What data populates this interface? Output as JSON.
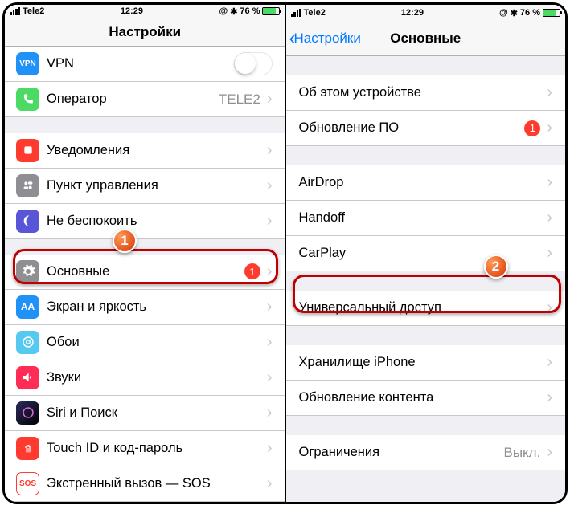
{
  "status": {
    "carrier": "Tele2",
    "time": "12:29",
    "battery_pct": "76 %"
  },
  "left": {
    "title": "Настройки",
    "rows": {
      "vpn": "VPN",
      "carrier": "Оператор",
      "carrier_value": "TELE2",
      "notifications": "Уведомления",
      "control_center": "Пункт управления",
      "dnd": "Не беспокоить",
      "general": "Основные",
      "general_badge": "1",
      "display": "Экран и яркость",
      "wallpaper": "Обои",
      "sounds": "Звуки",
      "siri": "Siri и Поиск",
      "touchid": "Touch ID и код-пароль",
      "sos": "Экстренный вызов — SOS"
    }
  },
  "right": {
    "back": "Настройки",
    "title": "Основные",
    "rows": {
      "about": "Об этом устройстве",
      "update": "Обновление ПО",
      "update_badge": "1",
      "airdrop": "AirDrop",
      "handoff": "Handoff",
      "carplay": "CarPlay",
      "accessibility": "Универсальный доступ",
      "storage": "Хранилище iPhone",
      "bg_refresh": "Обновление контента",
      "restrictions": "Ограничения",
      "restrictions_value": "Выкл."
    }
  },
  "callouts": {
    "c1": "1",
    "c2": "2"
  }
}
